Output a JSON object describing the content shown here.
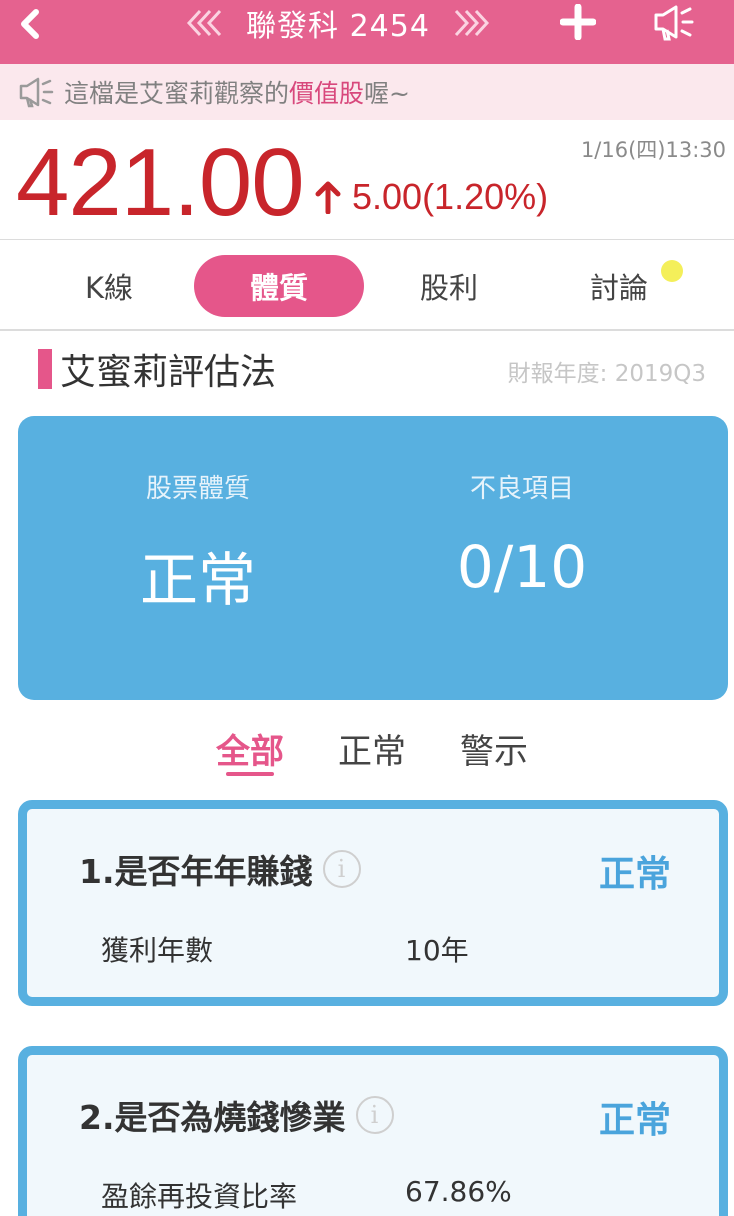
{
  "header": {
    "title": "聯發科 2454",
    "prev_label": "《",
    "next_label": "》"
  },
  "notice": {
    "prefix": "這檔是艾蜜莉觀察的",
    "highlight": "價值股",
    "suffix": "喔~"
  },
  "quote": {
    "price": "421.00",
    "change": "5.00(1.20%)",
    "timestamp": "1/16(四)13:30"
  },
  "tabs": [
    {
      "label": "K線"
    },
    {
      "label": "體質"
    },
    {
      "label": "股利"
    },
    {
      "label": "討論"
    }
  ],
  "active_tab": 1,
  "section": {
    "title": "艾蜜莉評估法",
    "report_year": "財報年度: 2019Q3"
  },
  "summary": {
    "health_label": "股票體質",
    "health_value": "正常",
    "bad_label": "不良項目",
    "bad_value": "0/10"
  },
  "filters": [
    {
      "label": "全部"
    },
    {
      "label": "正常"
    },
    {
      "label": "警示"
    }
  ],
  "cards": [
    {
      "title": "1.是否年年賺錢",
      "status": "正常",
      "metric_label": "獲利年數",
      "metric_value": "10年"
    },
    {
      "title": "2.是否為燒錢慘業",
      "status": "正常",
      "metric_label": "盈餘再投資比率",
      "metric_value": "67.86%"
    }
  ],
  "colors": {
    "brand_pink": "#e5628f",
    "price_red": "#c8252b",
    "summary_blue": "#58b0e0"
  },
  "icons": {
    "back": "chevron-left-icon",
    "add": "plus-icon",
    "announce": "megaphone-icon",
    "info": "info-circle-icon"
  }
}
